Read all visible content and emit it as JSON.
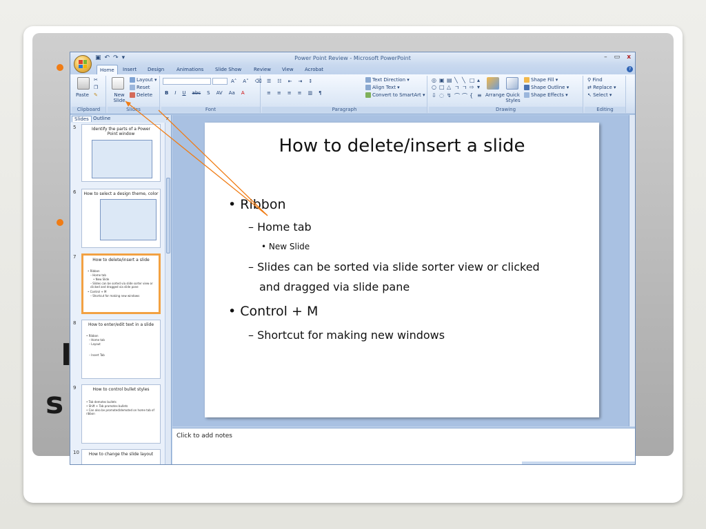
{
  "window": {
    "title": "Power Point Review - Microsoft PowerPoint",
    "controls": [
      "–",
      "▭",
      "x"
    ]
  },
  "tabs": [
    "Home",
    "Insert",
    "Design",
    "Animations",
    "Slide Show",
    "Review",
    "View",
    "Acrobat"
  ],
  "ribbon": {
    "clipboard": {
      "label": "Clipboard",
      "paste": "Paste"
    },
    "slides": {
      "label": "Slides",
      "new_slide": "New Slide",
      "layout": "Layout",
      "reset": "Reset",
      "delete": "Delete"
    },
    "font": {
      "label": "Font"
    },
    "paragraph": {
      "label": "Paragraph",
      "text_direction": "Text Direction",
      "align_text": "Align Text",
      "convert_smartart": "Convert to SmartArt"
    },
    "drawing": {
      "label": "Drawing",
      "arrange": "Arrange",
      "quick_styles": "Quick Styles",
      "shape_fill": "Shape Fill",
      "shape_outline": "Shape Outline",
      "shape_effects": "Shape Effects"
    },
    "editing": {
      "label": "Editing",
      "find": "Find",
      "replace": "Replace",
      "select": "Select"
    }
  },
  "pane": {
    "tabs": [
      "Slides",
      "Outline"
    ],
    "close": "x",
    "thumbnails": [
      {
        "num": "5",
        "title": "Identify the parts of a Power Point window",
        "lines": []
      },
      {
        "num": "6",
        "title": "How to select a design theme, color",
        "lines": []
      },
      {
        "num": "7",
        "title": "How to delete/insert a slide",
        "lines": [
          "• Ribbon",
          "– Home tab",
          "• New Slide",
          "– Slides can be sorted via slide sorter view or clicked and dragged via slide pane",
          "• Control + M",
          "– Shortcut for making new windows"
        ]
      },
      {
        "num": "8",
        "title": "How to enter/edit text in a slide",
        "lines": [
          "• Ribbon",
          "– Home tab",
          "– Layout",
          "– Insert Tab"
        ]
      },
      {
        "num": "9",
        "title": "How to control bullet styles",
        "lines": [
          "• Tab demotes bullets",
          "• Shift + Tab promotes bullets",
          "• Can also be promoted/demoted on home tab of ribbon"
        ]
      },
      {
        "num": "10",
        "title": "How to change the slide layout",
        "lines": []
      }
    ]
  },
  "slide": {
    "title": "How to delete/insert a slide",
    "bullets": [
      {
        "level": 1,
        "marker": "•",
        "text": "Ribbon"
      },
      {
        "level": 2,
        "marker": "–",
        "text": "Home tab"
      },
      {
        "level": 3,
        "marker": "•",
        "text": "New Slide"
      },
      {
        "level": 2,
        "marker": "–",
        "text": "Slides can be sorted via slide sorter view or clicked"
      },
      {
        "level": 2,
        "marker": "",
        "text": "and dragged via slide pane"
      },
      {
        "level": 1,
        "marker": "•",
        "text": "Control + M"
      },
      {
        "level": 2,
        "marker": "–",
        "text": "Shortcut for making new windows"
      }
    ]
  },
  "notes": {
    "placeholder": "Click to add notes"
  },
  "background": {
    "letter1": "I",
    "letter2": "s"
  },
  "colors": {
    "accent": "#f07c14",
    "ribbon": "#dde8f6",
    "selection": "#f2a142"
  }
}
